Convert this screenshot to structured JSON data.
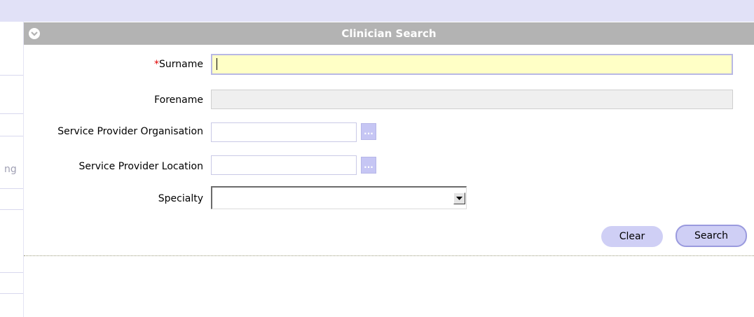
{
  "left_nav": {
    "fragment_text": "ng"
  },
  "panel": {
    "title": "Clinician Search",
    "toggle_icon": "chevron-down-icon"
  },
  "form": {
    "required_marker": "*",
    "surname": {
      "label": "Surname",
      "value": ""
    },
    "forename": {
      "label": "Forename",
      "value": ""
    },
    "organisation": {
      "label": "Service Provider Organisation",
      "value": "",
      "lookup_label": "..."
    },
    "location": {
      "label": "Service Provider Location",
      "value": "",
      "lookup_label": "..."
    },
    "specialty": {
      "label": "Specialty",
      "selected": ""
    }
  },
  "actions": {
    "clear_label": "Clear",
    "search_label": "Search"
  },
  "colors": {
    "header_bg": "#b3b3b3",
    "active_field_bg": "#ffffc6",
    "button_bg": "#cfcff5",
    "required": "#e00000"
  }
}
